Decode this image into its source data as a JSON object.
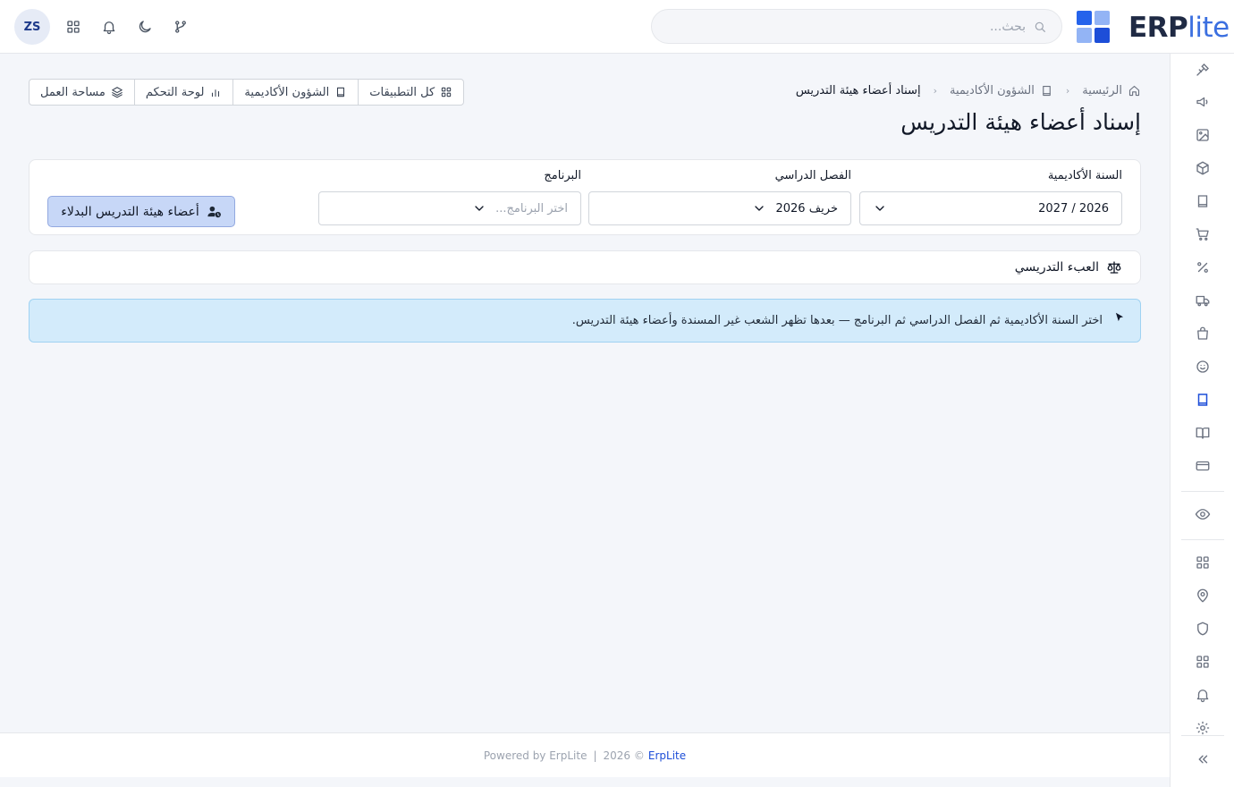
{
  "header": {
    "user_initials": "ZS",
    "search_placeholder": "بحث...",
    "logo": {
      "erp": "ERP",
      "lite": "lite"
    },
    "colors": {
      "brand_dark": "#1f2a44",
      "brand_accent": "#3b6fe0"
    }
  },
  "breadcrumb": {
    "home": "الرئيسية",
    "section": "الشؤون الأكاديمية",
    "current": "إسناد أعضاء هيئة التدريس"
  },
  "quick_links": [
    {
      "label": "كل التطبيقات",
      "icon": "grid-icon"
    },
    {
      "label": "الشؤون الأكاديمية",
      "icon": "book-icon"
    },
    {
      "label": "لوحة التحكم",
      "icon": "chart-bars-icon"
    },
    {
      "label": "مساحة العمل",
      "icon": "layers-icon"
    }
  ],
  "page": {
    "title": "إسناد أعضاء هيئة التدريس"
  },
  "filters": {
    "academic_year": {
      "label": "السنة الأكاديمية",
      "value": "2026 / 2027"
    },
    "semester": {
      "label": "الفصل الدراسي",
      "value": "خريف 2026"
    },
    "program": {
      "label": "البرنامج",
      "placeholder": "اختر البرنامج..."
    },
    "substitute_button": "أعضاء هيئة التدريس البدلاء"
  },
  "teaching_load": {
    "label": "العبء التدريسي"
  },
  "alert": {
    "text": "اختر السنة الأكاديمية ثم الفصل الدراسي ثم البرنامج — بعدها تظهر الشعب غير المسندة وأعضاء هيئة التدريس."
  },
  "footer": {
    "brand": "ErpLite",
    "copyright": "2026 ©",
    "powered": "Powered by ErpLite",
    "separator": "|"
  },
  "colors": {
    "accent": "#1d4ed8",
    "alert_bg": "#d3ebfb",
    "button_bg": "#c7d7f7"
  }
}
